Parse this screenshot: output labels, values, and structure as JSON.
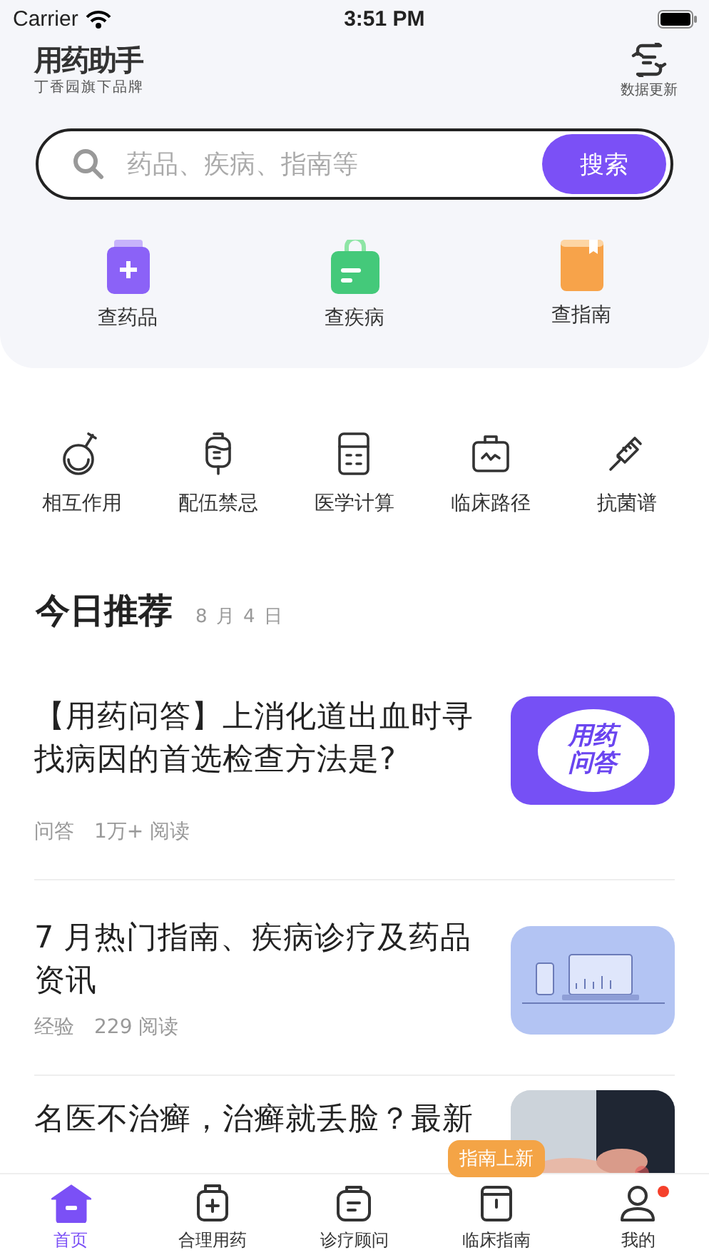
{
  "status_bar": {
    "carrier": "Carrier",
    "time": "3:51 PM"
  },
  "header": {
    "title": "用药助手",
    "subtitle": "丁香园旗下品牌",
    "update_label": "数据更新"
  },
  "search": {
    "placeholder": "药品、疾病、指南等",
    "button": "搜索"
  },
  "quick_links": [
    {
      "label": "查药品",
      "kind": "drug"
    },
    {
      "label": "查疾病",
      "kind": "disease"
    },
    {
      "label": "查指南",
      "kind": "guide"
    }
  ],
  "tools": [
    {
      "label": "相互作用",
      "kind": "flask"
    },
    {
      "label": "配伍禁忌",
      "kind": "drip"
    },
    {
      "label": "医学计算",
      "kind": "calc"
    },
    {
      "label": "临床路径",
      "kind": "kit"
    },
    {
      "label": "抗菌谱",
      "kind": "syringe"
    }
  ],
  "recommend": {
    "title": "今日推荐",
    "date": "8 月 4 日"
  },
  "articles": [
    {
      "title": "【用药问答】上消化道出血时寻找病因的首选检查方法是?",
      "category": "问答",
      "reads": "1万+ 阅读",
      "thumb": {
        "kind": "qa",
        "lines": [
          "用药",
          "问答"
        ]
      }
    },
    {
      "title": "7 月热门指南、疾病诊疗及药品资讯",
      "category": "经验",
      "reads": "229 阅读",
      "thumb": {
        "kind": "devices"
      }
    },
    {
      "title": "名医不治癣，治癣就丢脸？最新"
    }
  ],
  "tab_bar": [
    {
      "label": "首页",
      "kind": "home",
      "selected": true,
      "dot": false
    },
    {
      "label": "合理用药",
      "kind": "med",
      "selected": false,
      "dot": false
    },
    {
      "label": "诊疗顾问",
      "kind": "bag",
      "selected": false,
      "dot": false
    },
    {
      "label": "临床指南",
      "kind": "book",
      "selected": false,
      "dot": false,
      "tooltip": "指南上新"
    },
    {
      "label": "我的",
      "kind": "user",
      "selected": false,
      "dot": true
    }
  ]
}
